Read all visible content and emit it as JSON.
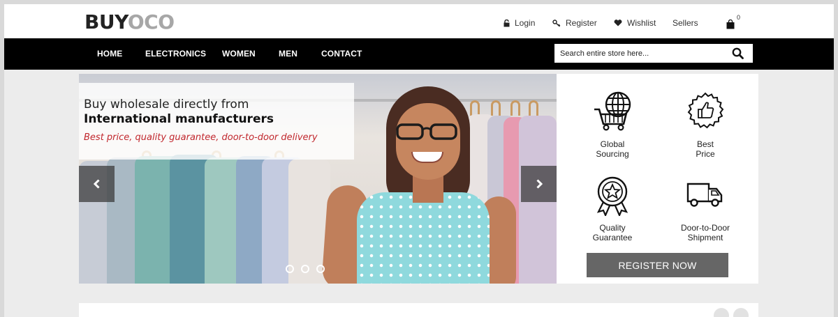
{
  "brand": {
    "part1": "BUY",
    "part2": "OCO"
  },
  "top_links": {
    "login": "Login",
    "register": "Register",
    "wishlist": "Wishlist",
    "sellers": "Sellers",
    "cart_count": "0"
  },
  "nav": {
    "items": [
      "HOME",
      "ELECTRONICS",
      "WOMEN",
      "MEN",
      "CONTACT"
    ]
  },
  "search": {
    "placeholder": "Search entire store here..."
  },
  "hero": {
    "line1": "Buy wholesale directly from",
    "line2": "International manufacturers",
    "line3": "Best price, quality guarantee, door-to-door delivery",
    "slide_count": 3,
    "active_slide": 1
  },
  "features": {
    "items": [
      {
        "label_line1": "Global",
        "label_line2": "Sourcing",
        "icon": "globe-cart-icon"
      },
      {
        "label_line1": "Best",
        "label_line2": "Price",
        "icon": "thumbs-up-badge-icon"
      },
      {
        "label_line1": "Quality",
        "label_line2": "Guarantee",
        "icon": "award-ribbon-icon"
      },
      {
        "label_line1": "Door-to-Door",
        "label_line2": "Shipment",
        "icon": "truck-icon"
      }
    ],
    "cta": "REGISTER NOW"
  },
  "colors": {
    "nav_bg": "#000000",
    "accent_red": "#c1272d",
    "cta_bg": "#666666",
    "logo_gray": "#a7a7a7"
  }
}
